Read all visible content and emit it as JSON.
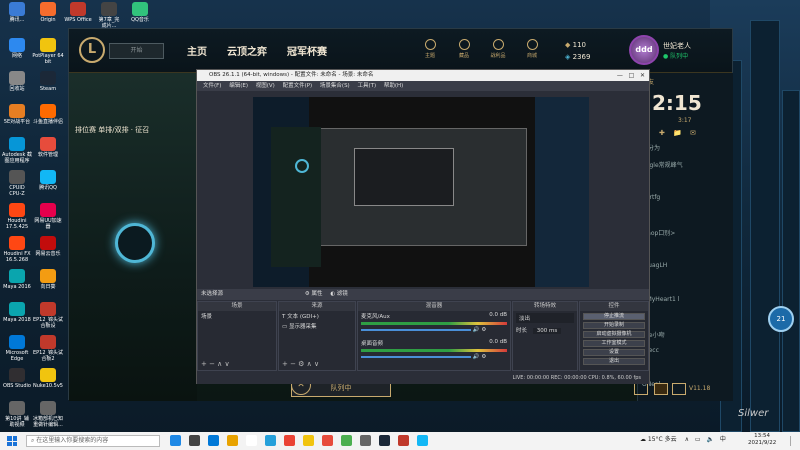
{
  "desktop": {
    "icons": [
      {
        "label": "腾讯...",
        "label2": "",
        "color": "#3a7bd5"
      },
      {
        "label": "Origin",
        "label2": "",
        "color": "#f56c2d"
      },
      {
        "label": "WPS Office",
        "label2": "",
        "color": "#c0392b"
      },
      {
        "label": "第7章_完",
        "label2": "成片...",
        "color": "#444"
      },
      {
        "label": "QQ音乐",
        "label2": "",
        "color": "#31c27c"
      },
      {
        "label": "网络",
        "label2": "",
        "color": "#2d89ef"
      },
      {
        "label": "PotPlayer 64",
        "label2": "bit",
        "color": "#f1c40f"
      },
      {
        "label": "回收站",
        "label2": "",
        "color": "#888"
      },
      {
        "label": "Steam",
        "label2": "",
        "color": "#1b2838"
      },
      {
        "label": "5E对战平台",
        "label2": "",
        "color": "#e67e22"
      },
      {
        "label": "斗鱼直播伴侣",
        "label2": "",
        "color": "#ff6a00"
      },
      {
        "label": "Autodesk 截",
        "label2": "图应用程序",
        "color": "#0696d7"
      },
      {
        "label": "软件管理",
        "label2": "",
        "color": "#e74c3c"
      },
      {
        "label": "CPUID",
        "label2": "CPU-Z",
        "color": "#555"
      },
      {
        "label": "腾讯QQ",
        "label2": "",
        "color": "#12b7f5"
      },
      {
        "label": "Houdini",
        "label2": "17.5.425",
        "color": "#ff4713"
      },
      {
        "label": "网易UU加速",
        "label2": "器",
        "color": "#e6004c"
      },
      {
        "label": "Houdini FX",
        "label2": "16.5.268",
        "color": "#ff4713"
      },
      {
        "label": "网易云音乐",
        "label2": "",
        "color": "#c20c0c"
      },
      {
        "label": "Maya 2016",
        "label2": "",
        "color": "#0aa5ae"
      },
      {
        "label": "向日葵",
        "label2": "",
        "color": "#f39c12"
      },
      {
        "label": "Maya 2018",
        "label2": "",
        "color": "#0aa5ae"
      },
      {
        "label": "EP12_锦头试",
        "label2": "合板设",
        "color": "#c0392b"
      },
      {
        "label": "Microsoft",
        "label2": "Edge",
        "color": "#0078d7"
      },
      {
        "label": "EP12_锦头试",
        "label2": "合板2",
        "color": "#c0392b"
      },
      {
        "label": "OBS Studio",
        "label2": "",
        "color": "#302e31"
      },
      {
        "label": "Nuke10.5v5",
        "label2": "",
        "color": "#f1c40f"
      },
      {
        "label": "第10讲_辅",
        "label2": "助视频",
        "color": "#666"
      },
      {
        "label": "冰箱部机已知",
        "label2": "重做针编辑...",
        "color": "#666"
      }
    ]
  },
  "lol": {
    "play_label": "开始",
    "tabs": [
      "主页",
      "云顶之弈",
      "冠军杯赛"
    ],
    "top_icons": [
      "主题",
      "藏品",
      "战利品",
      "商城"
    ],
    "rp": "110",
    "be": "2369",
    "avatar_text": "ddd",
    "player_name": "世妃老人",
    "player_status": "队列中",
    "mode_header": "排位赛 单排/双排 · 征召",
    "queue_label": "队列中",
    "clock": "2:15",
    "elapsed": "3:17",
    "social_label": "好友",
    "friends": [
      "些分为",
      "Eagle常规峰气",
      "?",
      "gertfg",
      "?",
      "Tiaop口别>",
      "?",
      "rhuagLH",
      "9",
      "rfMyHeart1 l",
      "?",
      "ylie小吻",
      "ccecc",
      "r",
      "ONeal"
    ],
    "version": "V11.18",
    "badge": "21"
  },
  "obs": {
    "title": "OBS 26.1.1 (64-bit, windows) - 配置文件: 未命名 - 场景: 未命名",
    "controls": [
      "—",
      "□",
      "✕"
    ],
    "menu": [
      "文件(F)",
      "编辑(E)",
      "视图(V)",
      "配置文件(P)",
      "场景集合(S)",
      "工具(T)",
      "帮助(H)"
    ],
    "context_left": "未选择源",
    "context_props": "属性",
    "context_filters": "滤镜",
    "docks": {
      "scenes": {
        "title": "场景",
        "items": [
          "场景"
        ]
      },
      "sources": {
        "title": "来源",
        "items": [
          "文本 (GDI+)",
          "显示器采集"
        ]
      },
      "mixer": {
        "title": "混音器",
        "ch1": "麦克风/Aux",
        "ch1_db": "0.0 dB",
        "ch2": "桌面音频",
        "ch2_db": "0.0 dB"
      },
      "transitions": {
        "title": "转场特效",
        "type": "淡出",
        "duration_label": "时长",
        "duration": "300 ms"
      },
      "controls": {
        "title": "控件",
        "buttons": [
          "停止推流",
          "开始录制",
          "启动虚拟摄像机",
          "工作室模式",
          "设置",
          "退出"
        ]
      }
    },
    "status": "LIVE: 00:00:00   REC: 00:00:00   CPU: 0.8%, 60.00 fps"
  },
  "taskbar": {
    "search_placeholder": "在这里输入你要搜索的内容",
    "weather": "15°C 多云",
    "ime": "中",
    "time": "13:54",
    "date": "2021/9/22",
    "app_colors": [
      "#1e88e5",
      "#444",
      "#0078d7",
      "#e8a200",
      "#fff",
      "#25a0da",
      "#ea4335",
      "#f1c40f",
      "#e74c3c",
      "#4caf50",
      "#666",
      "#1b2838",
      "#c0392b",
      "#12b7f5"
    ]
  },
  "signature": "Silwer"
}
